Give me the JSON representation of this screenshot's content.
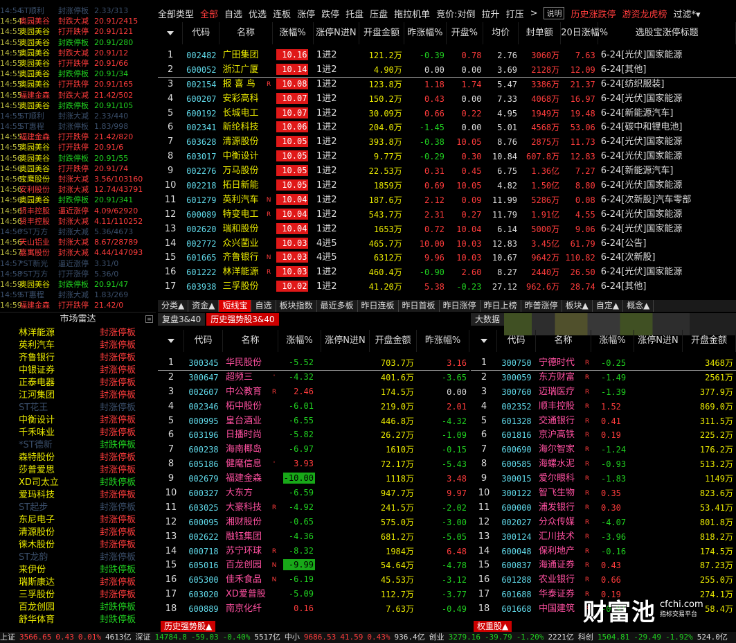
{
  "log": [
    [
      "14:54",
      "ST顺利",
      "封涨停板",
      "2.33/313",
      "dim"
    ],
    [
      "14:54",
      "奥园美谷",
      "封跌大减",
      "20.91/2415",
      "r"
    ],
    [
      "14:55",
      "奥园美谷",
      "打开跌停",
      "20.91/121",
      ""
    ],
    [
      "14:55",
      "奥园美谷",
      "封跌停板",
      "20.91/280",
      "g"
    ],
    [
      "14:55",
      "奥园美谷",
      "封跌大减",
      "20.91/12",
      ""
    ],
    [
      "14:55",
      "奥园美谷",
      "打开跌停",
      "20.91/66",
      ""
    ],
    [
      "14:55",
      "奥园美谷",
      "封跌停板",
      "20.91/34",
      "g"
    ],
    [
      "14:55",
      "奥园美谷",
      "打开跌停",
      "20.91/165",
      ""
    ],
    [
      "14:55",
      "福建金森",
      "封跌大减",
      "21.42/502",
      "r"
    ],
    [
      "14:55",
      "奥园美谷",
      "封跌停板",
      "20.91/105",
      "g"
    ],
    [
      "14:55",
      "ST顺利",
      "封涨大减",
      "2.33/440",
      "dim"
    ],
    [
      "14:55",
      "ST惠程",
      "封涨停板",
      "1.83/998",
      "dim"
    ],
    [
      "14:55",
      "福建金森",
      "打开跌停",
      "21.42/820",
      "r"
    ],
    [
      "14:55",
      "奥园美谷",
      "打开跌停",
      "20.91/6",
      ""
    ],
    [
      "14:56",
      "奥园美谷",
      "封跌停板",
      "20.91/55",
      "g"
    ],
    [
      "14:56",
      "奥园美谷",
      "打开跌停",
      "20.91/74",
      ""
    ],
    [
      "14:56",
      "宝鹰股份",
      "封涨大减",
      "3.56/103160",
      ""
    ],
    [
      "14:56",
      "安利股份",
      "封涨大减",
      "12.74/43791",
      "r"
    ],
    [
      "14:56",
      "奥园美谷",
      "封跌停板",
      "20.91/341",
      "g"
    ],
    [
      "14:56",
      "贤丰控股",
      "逼近涨停",
      "4.09/62920",
      "r"
    ],
    [
      "14:56",
      "贤丰控股",
      "封涨大减",
      "4.11/110252",
      "r"
    ],
    [
      "14:56",
      "*ST万方",
      "封涨大减",
      "5.36/4673",
      "dim"
    ],
    [
      "14:56",
      "天山铝业",
      "封涨大减",
      "8.67/28789",
      "r"
    ],
    [
      "14:57",
      "嘉寓股份",
      "封涨大减",
      "4.44/147093",
      "r"
    ],
    [
      "14:57",
      "*ST新光",
      "逼近涨停",
      "3.31/0",
      "dim"
    ],
    [
      "14:58",
      "*ST万方",
      "打开涨停",
      "5.36/0",
      "dim"
    ],
    [
      "14:59",
      "奥园美谷",
      "封跌停板",
      "20.91/47",
      "g"
    ],
    [
      "14:59",
      "ST惠程",
      "封涨大减",
      "1.83/269",
      "dim"
    ],
    [
      "14:59",
      "福建金森",
      "打开跌停",
      "21.42/0",
      "r"
    ]
  ],
  "radar_title": "市场雷达",
  "radar": [
    [
      "林洋能源",
      "封涨停板",
      ""
    ],
    [
      "英利汽车",
      "封涨停板",
      ""
    ],
    [
      "齐鲁银行",
      "封涨停板",
      ""
    ],
    [
      "中银证券",
      "封涨停板",
      ""
    ],
    [
      "正泰电器",
      "封涨停板",
      ""
    ],
    [
      "江河集团",
      "封涨停板",
      ""
    ],
    [
      "ST花王",
      "封涨停板",
      "dim"
    ],
    [
      "中衡设计",
      "封涨停板",
      ""
    ],
    [
      "千禾味业",
      "封涨停板",
      ""
    ],
    [
      "*ST德新",
      "封跌停板",
      "dim"
    ],
    [
      "森特股份",
      "封涨停板",
      ""
    ],
    [
      "莎普爱思",
      "封涨停板",
      ""
    ],
    [
      "XD司太立",
      "封跌停板",
      ""
    ],
    [
      "爱玛科技",
      "封涨停板",
      ""
    ],
    [
      "ST起步",
      "封涨停板",
      "dim"
    ],
    [
      "东尼电子",
      "封涨停板",
      ""
    ],
    [
      "清源股份",
      "封涨停板",
      ""
    ],
    [
      "徕木股份",
      "封涨停板",
      ""
    ],
    [
      "ST龙韵",
      "封涨停板",
      "dim"
    ],
    [
      "来伊份",
      "封跌停板",
      ""
    ],
    [
      "瑞斯康达",
      "封涨停板",
      ""
    ],
    [
      "三孚股份",
      "封涨停板",
      ""
    ],
    [
      "百龙创园",
      "封跌停板",
      ""
    ],
    [
      "舒华体育",
      "封跌停板",
      ""
    ]
  ],
  "topbar": {
    "items": [
      "全部类型",
      "全部",
      "自选",
      "优选",
      "连板",
      "涨停",
      "跌停",
      "托盘",
      "压盘",
      "拖拉机单",
      "竞价:对倒",
      "拉升",
      "打压"
    ],
    "more": ">",
    "explain": "说明",
    "right": [
      "历史涨跌停",
      "游资龙虎榜",
      "过滤*▾"
    ]
  },
  "top_headers": [
    "代码",
    "名称",
    "涨幅%",
    "涨停N进N",
    "开盘金额",
    "昨涨幅%",
    "开盘%",
    "均价",
    "封单额",
    "20日涨幅%",
    "选股宝涨停标题"
  ],
  "top_rows": [
    [
      "1",
      "002482",
      "广田集团",
      "",
      "10.16",
      "1进2",
      "121.2万",
      "-0.39",
      "0.78",
      "2.76",
      "3060万",
      "7.63",
      "6-24[光伏]国家能源"
    ],
    [
      "2",
      "600052",
      "浙江广厦",
      "",
      "10.14",
      "1进2",
      "4.90万",
      "0.00",
      "0.00",
      "3.69",
      "2128万",
      "12.09",
      "6-24[其他]"
    ],
    [
      "3",
      "002154",
      "报 喜 鸟",
      "R",
      "10.08",
      "1进2",
      "123.8万",
      "1.18",
      "1.74",
      "5.47",
      "3386万",
      "21.37",
      "6-24[纺织服装]"
    ],
    [
      "4",
      "600207",
      "安彩高科",
      "",
      "10.07",
      "1进2",
      "150.2万",
      "0.43",
      "0.00",
      "7.33",
      "4068万",
      "16.97",
      "6-24[光伏]国家能源"
    ],
    [
      "5",
      "600192",
      "长城电工",
      "",
      "10.07",
      "1进2",
      "30.09万",
      "0.66",
      "0.22",
      "4.95",
      "1949万",
      "19.48",
      "6-24[新能源汽车]"
    ],
    [
      "6",
      "002341",
      "新纶科技",
      "",
      "10.06",
      "1进2",
      "204.0万",
      "-1.45",
      "0.00",
      "5.01",
      "4568万",
      "53.06",
      "6-24[碳中和锂电池]"
    ],
    [
      "7",
      "603628",
      "清源股份",
      "",
      "10.05",
      "1进2",
      "393.8万",
      "-0.38",
      "10.05",
      "8.76",
      "2875万",
      "11.73",
      "6-24[光伏]国家能源"
    ],
    [
      "8",
      "603017",
      "中衡设计",
      "",
      "10.05",
      "1进2",
      "9.77万",
      "-0.29",
      "0.30",
      "10.84",
      "607.8万",
      "12.83",
      "6-24[光伏]国家能源"
    ],
    [
      "9",
      "002276",
      "万马股份",
      "",
      "10.05",
      "1进2",
      "22.53万",
      "0.31",
      "0.45",
      "6.75",
      "1.36亿",
      "7.27",
      "6-24[新能源汽车]"
    ],
    [
      "10",
      "002218",
      "拓日新能",
      "",
      "10.05",
      "1进2",
      "1859万",
      "0.69",
      "10.05",
      "4.82",
      "1.50亿",
      "8.80",
      "6-24[光伏]国家能源"
    ],
    [
      "11",
      "601279",
      "英利汽车",
      "N",
      "10.04",
      "1进2",
      "187.6万",
      "2.12",
      "0.09",
      "11.99",
      "5286万",
      "0.08",
      "6-24[次新股]汽车零部"
    ],
    [
      "12",
      "600089",
      "特变电工",
      "R",
      "10.04",
      "1进2",
      "543.7万",
      "2.31",
      "0.27",
      "11.79",
      "1.91亿",
      "4.55",
      "6-24[光伏]国家能源"
    ],
    [
      "13",
      "002620",
      "瑞和股份",
      "",
      "10.04",
      "1进2",
      "1653万",
      "0.72",
      "10.04",
      "6.14",
      "5000万",
      "9.06",
      "6-24[光伏]国家能源"
    ],
    [
      "14",
      "002772",
      "众兴菌业",
      "",
      "10.03",
      "4进5",
      "465.7万",
      "10.00",
      "10.03",
      "12.83",
      "3.45亿",
      "61.79",
      "6-24[公告]"
    ],
    [
      "15",
      "601665",
      "齐鲁银行",
      "N",
      "10.03",
      "4进5",
      "6312万",
      "9.96",
      "10.03",
      "10.67",
      "9642万",
      "110.82",
      "6-24[次新股]"
    ],
    [
      "16",
      "601222",
      "林洋能源",
      "R",
      "10.03",
      "1进2",
      "460.4万",
      "-0.90",
      "2.60",
      "8.27",
      "2440万",
      "26.50",
      "6-24[光伏]国家能源"
    ],
    [
      "17",
      "603938",
      "三孚股份",
      "",
      "10.02",
      "1进2",
      "41.20万",
      "5.38",
      "-0.23",
      "27.12",
      "962.6万",
      "28.74",
      "6-24[其他]"
    ]
  ],
  "tabs": [
    "分类▲",
    "资金▲",
    "短线宝",
    "自选",
    "板块指数",
    "最近多板",
    "昨日连板",
    "昨日首板",
    "昨日涨停",
    "昨日上榜",
    "昨普涨停",
    "板块▲",
    "自定▲",
    "概念▲"
  ],
  "tabs_active": 2,
  "subtabs": [
    "复盘3&40",
    "历史强势股3&40"
  ],
  "subtabs_active": 1,
  "bigtab": "大数据",
  "bl_headers": [
    "代码",
    "名称",
    "涨幅%",
    "涨停N进N",
    "开盘金额",
    "昨涨幅%"
  ],
  "bl_rows": [
    [
      "1",
      "300345",
      "华民股份",
      "",
      "-5.52",
      "",
      "703.7万",
      "3.16"
    ],
    [
      "2",
      "300647",
      "超频三",
      "'",
      "-4.32",
      "",
      "401.6万",
      "-3.65"
    ],
    [
      "3",
      "002607",
      "中公教育",
      "R",
      "2.46",
      "",
      "174.5万",
      "0.00"
    ],
    [
      "4",
      "002346",
      "柘中股份",
      "",
      "-6.01",
      "",
      "219.0万",
      "2.01"
    ],
    [
      "5",
      "000995",
      "皇台酒业",
      "",
      "-6.55",
      "",
      "446.8万",
      "-4.32"
    ],
    [
      "6",
      "603196",
      "日播时尚",
      "",
      "-5.82",
      "",
      "26.27万",
      "-1.09"
    ],
    [
      "7",
      "600238",
      "海南椰岛",
      "",
      "-6.97",
      "",
      "1610万",
      "-0.15"
    ],
    [
      "8",
      "605186",
      "健麾信息",
      "'",
      "3.93",
      "",
      "72.17万",
      "-5.43"
    ],
    [
      "9",
      "002679",
      "福建金森",
      "",
      "-10.00",
      "",
      "1118万",
      "3.48"
    ],
    [
      "10",
      "600327",
      "大东方",
      "",
      "-6.59",
      "",
      "947.7万",
      "9.97"
    ],
    [
      "11",
      "603025",
      "大豪科技",
      "R",
      "-4.92",
      "",
      "241.5万",
      "-2.02"
    ],
    [
      "12",
      "600095",
      "湘财股份",
      "",
      "-0.65",
      "",
      "575.0万",
      "-3.00"
    ],
    [
      "13",
      "002622",
      "融钰集团",
      "",
      "-4.36",
      "",
      "681.2万",
      "-5.05"
    ],
    [
      "14",
      "000718",
      "苏宁环球",
      "R",
      "-8.32",
      "",
      "1984万",
      "6.48"
    ],
    [
      "15",
      "605016",
      "百龙创园",
      "N",
      "-9.99",
      "",
      "54.64万",
      "-4.78"
    ],
    [
      "16",
      "605300",
      "佳禾食品",
      "N",
      "-6.19",
      "",
      "45.53万",
      "-3.12"
    ],
    [
      "17",
      "603020",
      "XD爱普股",
      "",
      "-5.09",
      "",
      "112.7万",
      "-3.77"
    ],
    [
      "18",
      "600889",
      "南京化纤",
      "",
      "0.16",
      "",
      "7.63万",
      "-0.49"
    ]
  ],
  "br_headers": [
    "代码",
    "名称",
    "涨幅%",
    "涨停N进N",
    "开盘金额"
  ],
  "br_rows": [
    [
      "1",
      "300750",
      "宁德时代",
      "R",
      "-0.25",
      "3468万"
    ],
    [
      "2",
      "300059",
      "东方财富",
      "R",
      "-1.49",
      "2561万"
    ],
    [
      "3",
      "300760",
      "迈瑞医疗",
      "R",
      "-1.39",
      "377.9万"
    ],
    [
      "4",
      "002352",
      "顺丰控股",
      "R",
      "1.52",
      "869.0万"
    ],
    [
      "5",
      "601328",
      "交通银行",
      "R",
      "0.41",
      "311.5万"
    ],
    [
      "6",
      "601816",
      "京沪高铁",
      "R",
      "0.19",
      "225.2万"
    ],
    [
      "7",
      "600690",
      "海尔智家",
      "R",
      "-1.24",
      "176.2万"
    ],
    [
      "8",
      "600585",
      "海螺水泥",
      "R",
      "-0.93",
      "513.2万"
    ],
    [
      "9",
      "300015",
      "爱尔眼科",
      "R",
      "-1.83",
      "1149万"
    ],
    [
      "10",
      "300122",
      "智飞生物",
      "R",
      "0.35",
      "823.6万"
    ],
    [
      "11",
      "600000",
      "浦发银行",
      "R",
      "0.30",
      "53.41万"
    ],
    [
      "12",
      "002027",
      "分众传媒",
      "R",
      "-4.07",
      "801.8万"
    ],
    [
      "13",
      "300124",
      "汇川技术",
      "R",
      "-3.96",
      "818.2万"
    ],
    [
      "14",
      "600048",
      "保利地产",
      "R",
      "-0.16",
      "174.5万"
    ],
    [
      "15",
      "600837",
      "海通证券",
      "R",
      "0.43",
      "87.23万"
    ],
    [
      "16",
      "601288",
      "农业银行",
      "R",
      "0.66",
      "255.0万"
    ],
    [
      "17",
      "601688",
      "华泰证券",
      "R",
      "0.19",
      "274.1万"
    ],
    [
      "18",
      "601668",
      "中国建筑",
      "R",
      "-0.91",
      "58.4万"
    ]
  ],
  "btab_left": "历史强势股▲",
  "btab_right": "权重股▲",
  "status": [
    [
      "上证",
      "#ddd"
    ],
    [
      "3566.65",
      "#ff3c3c"
    ],
    [
      "0.43",
      "#ff3c3c"
    ],
    [
      "0.01%",
      "#ff3c3c"
    ],
    [
      "4613亿",
      "#ddd"
    ],
    [
      "深证",
      "#ddd"
    ],
    [
      "14784.8",
      "#20d020"
    ],
    [
      "-59.03",
      "#20d020"
    ],
    [
      "-0.40%",
      "#20d020"
    ],
    [
      "5517亿",
      "#ddd"
    ],
    [
      "中小",
      "#ddd"
    ],
    [
      "9686.53",
      "#ff3c3c"
    ],
    [
      "41.59",
      "#ff3c3c"
    ],
    [
      "0.43%",
      "#ff3c3c"
    ],
    [
      "936.4亿",
      "#ddd"
    ],
    [
      "创业",
      "#ddd"
    ],
    [
      "3279.16",
      "#20d020"
    ],
    [
      "-39.79",
      "#20d020"
    ],
    [
      "-1.20%",
      "#20d020"
    ],
    [
      "2221亿",
      "#ddd"
    ],
    [
      "科创",
      "#ddd"
    ],
    [
      "1504.81",
      "#20d020"
    ],
    [
      "-29.49",
      "#20d020"
    ],
    [
      "-1.92%",
      "#20d020"
    ],
    [
      "524.0亿",
      "#ddd"
    ]
  ],
  "watermark": {
    "big": "财富池",
    "site": "cfchi.com",
    "sub": "指标交易平台"
  },
  "colors": {
    "up": "#ff3c3c",
    "down": "#20d020",
    "code": "#60d8e8",
    "name": "#e8e800",
    "accent": "#cc0000"
  }
}
